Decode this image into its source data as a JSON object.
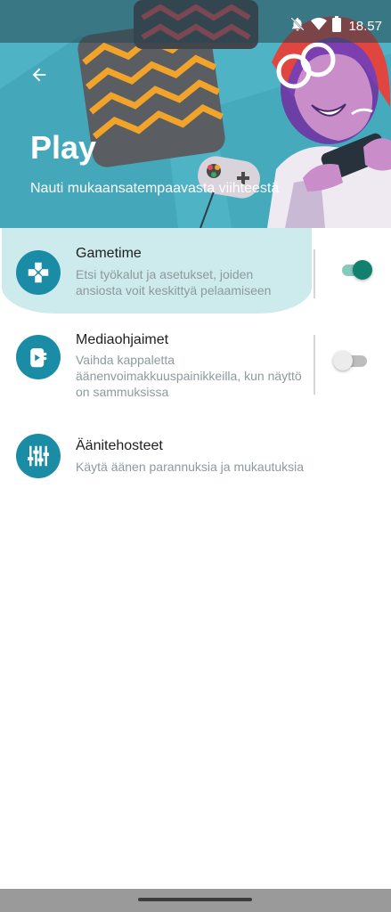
{
  "status_bar": {
    "time": "18.57",
    "icons": [
      "notifications-off-icon",
      "wifi-icon",
      "battery-icon"
    ]
  },
  "header": {
    "back_icon": "arrow-back-icon",
    "title": "Play",
    "subtitle": "Nauti mukaansatempaavasta viihteestä"
  },
  "settings": [
    {
      "icon": "gamepad-icon",
      "title": "Gametime",
      "description": "Etsi työkalut ja asetukset, joiden ansiosta voit keskittyä pelaamiseen",
      "toggle": true,
      "highlighted": true
    },
    {
      "icon": "media-controls-icon",
      "title": "Mediaohjaimet",
      "description": "Vaihda kappaletta äänenvoimakkuuspainikkeilla, kun näyttö on sammuksissa",
      "toggle": false,
      "highlighted": false
    },
    {
      "icon": "equalizer-icon",
      "title": "Äänitehosteet",
      "description": "Käytä äänen parannuksia ja mukautuksia",
      "toggle": null,
      "highlighted": false
    }
  ],
  "colors": {
    "hero_background": "#4fb3c6",
    "icon_circle": "#1b8ca6",
    "toggle_on_thumb": "#12806e",
    "toggle_on_track": "#86c9bd",
    "toggle_off_thumb": "#ececec",
    "toggle_off_track": "#bdbdbd",
    "highlight": "#cdeaec"
  }
}
